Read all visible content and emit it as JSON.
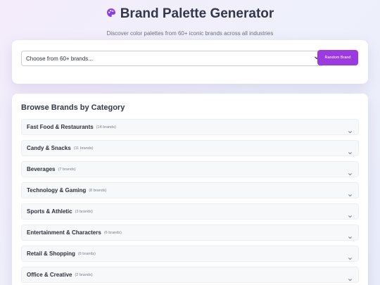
{
  "header": {
    "title": "Brand Palette Generator",
    "subtitle": "Discover color palettes from 60+ iconic brands across all industries",
    "icon": "palette-icon"
  },
  "brand_select": {
    "value": "Choose from 60+ brands...",
    "random_button_label": "Random Brand"
  },
  "browse": {
    "title": "Browse Brands by Category",
    "categories": [
      {
        "name": "Fast Food & Restaurants",
        "count": "(14 brands)"
      },
      {
        "name": "Candy & Snacks",
        "count": "(11 brands)"
      },
      {
        "name": "Beverages",
        "count": "(7 brands)"
      },
      {
        "name": "Technology & Gaming",
        "count": "(8 brands)"
      },
      {
        "name": "Sports & Athletic",
        "count": "(3 brands)"
      },
      {
        "name": "Entertainment & Characters",
        "count": "(6 brands)"
      },
      {
        "name": "Retail & Shopping",
        "count": "(6 brands)"
      },
      {
        "name": "Office & Creative",
        "count": "(2 brands)"
      }
    ]
  },
  "colors": {
    "accent": "#9c3ae0",
    "title_text": "#34364a"
  }
}
